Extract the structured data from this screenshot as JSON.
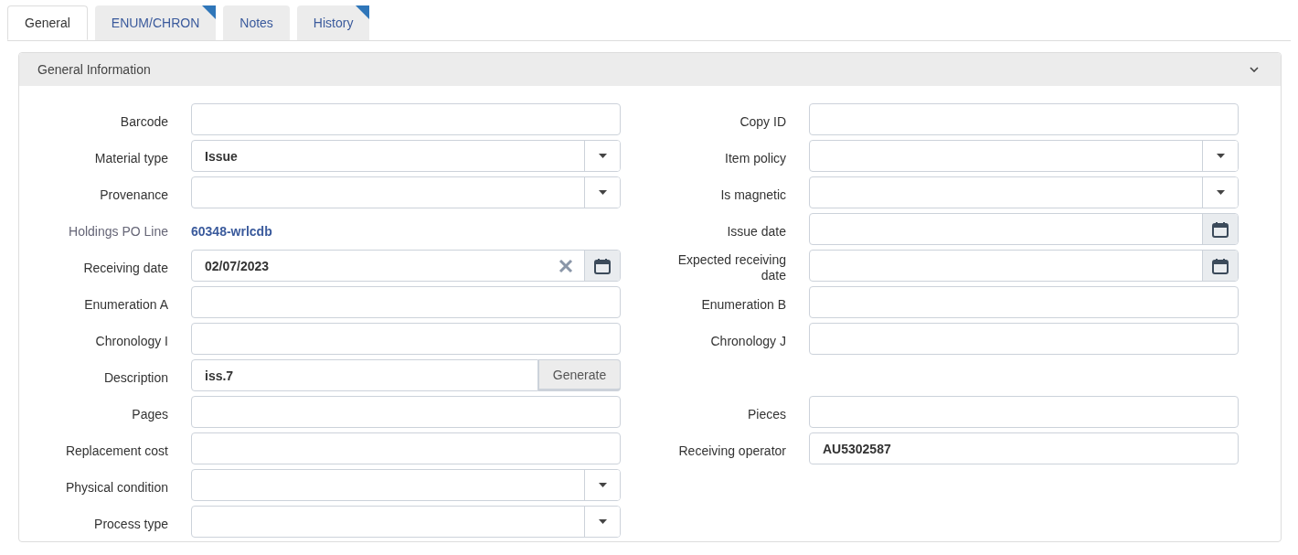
{
  "tabs": [
    {
      "label": "General",
      "selected": true,
      "flagged": false
    },
    {
      "label": "ENUM/CHRON",
      "selected": false,
      "flagged": true
    },
    {
      "label": "Notes",
      "selected": false,
      "flagged": false
    },
    {
      "label": "History",
      "selected": false,
      "flagged": true
    }
  ],
  "panel": {
    "title": "General Information",
    "expanded": true
  },
  "rows": [
    {
      "left": {
        "label": "Barcode",
        "kind": "text"
      },
      "right": {
        "label": "Copy ID",
        "kind": "text"
      }
    },
    {
      "left": {
        "label": "Material type",
        "kind": "select",
        "value": "Issue"
      },
      "right": {
        "label": "Item policy",
        "kind": "select"
      }
    },
    {
      "left": {
        "label": "Provenance",
        "kind": "select"
      },
      "right": {
        "label": "Is magnetic",
        "kind": "select"
      }
    },
    {
      "left": {
        "label": "Holdings PO Line",
        "kind": "link",
        "value": "60348-wrlcdb"
      },
      "right": {
        "label": "Issue date",
        "kind": "date"
      }
    },
    {
      "left": {
        "label": "Receiving date",
        "kind": "date",
        "value": "02/07/2023"
      },
      "right": {
        "label": "Expected receiving date",
        "kind": "date"
      }
    },
    {
      "left": {
        "label": "Enumeration A",
        "kind": "text"
      },
      "right": {
        "label": "Enumeration B",
        "kind": "text"
      }
    },
    {
      "left": {
        "label": "Chronology I",
        "kind": "text"
      },
      "right": {
        "label": "Chronology J",
        "kind": "text"
      }
    },
    {
      "left": {
        "label": "Description",
        "kind": "generate",
        "value": "iss.7",
        "button": "Generate"
      }
    },
    {
      "left": {
        "label": "Pages",
        "kind": "text"
      },
      "right": {
        "label": "Pieces",
        "kind": "text"
      }
    },
    {
      "left": {
        "label": "Replacement cost",
        "kind": "text"
      },
      "right": {
        "label": "Receiving operator",
        "kind": "text",
        "value": "AU5302587"
      }
    },
    {
      "left": {
        "label": "Physical condition",
        "kind": "select"
      }
    },
    {
      "left": {
        "label": "Process type",
        "kind": "select"
      }
    }
  ]
}
